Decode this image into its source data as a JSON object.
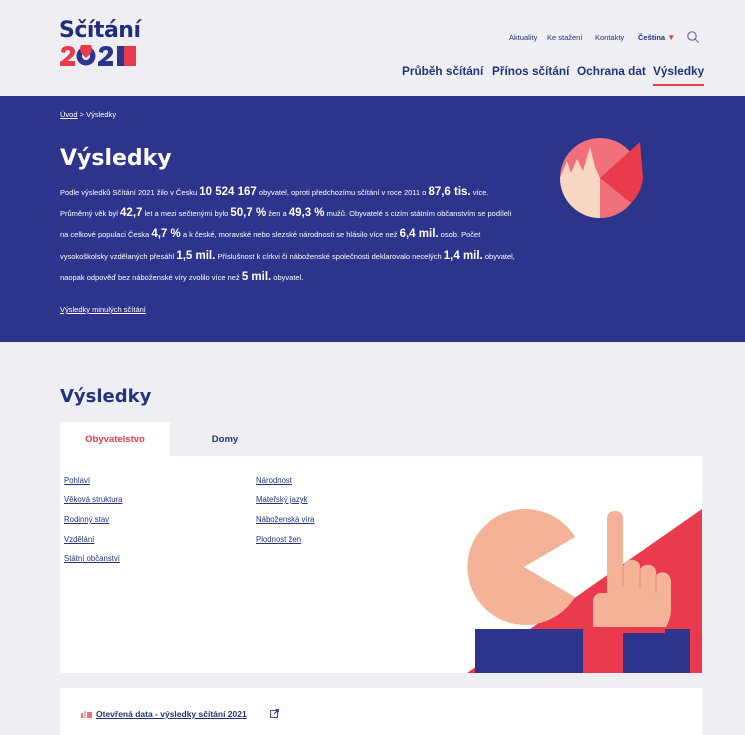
{
  "logo": {
    "text": "Sčítání",
    "year": "2021"
  },
  "utility_nav": [
    {
      "label": "Aktuality"
    },
    {
      "label": "Ke stažení"
    },
    {
      "label": "Kontakty"
    }
  ],
  "language": {
    "label": "Čeština",
    "caret": "▼"
  },
  "main_nav": [
    {
      "label": "Průběh sčítání"
    },
    {
      "label": "Přínos sčítání"
    },
    {
      "label": "Ochrana dat"
    },
    {
      "label": "Výsledky",
      "active": true
    }
  ],
  "breadcrumb": {
    "home": "Úvod",
    "separator": " > ",
    "current": "Výsledky"
  },
  "hero": {
    "title": "Výsledky",
    "p": [
      "Podle výsledků Sčítání 2021 žilo v Česku ",
      "10 524 167",
      " obyvatel, oproti předchozímu sčítání v roce 2011 o ",
      "87,6 tis.",
      " více. Průměrný věk byl ",
      "42,7",
      " let a mezi sečtenými bylo ",
      "50,7 %",
      " žen a ",
      "49,3 %",
      " mužů. Obyvatelé s cizím státním občanstvím se podíleli na celkové populaci Česka ",
      "4,7 %",
      " a k české, moravské nebo slezské národnosti se hlásilo více než ",
      "6,4 mil.",
      " osob. Počet vysokoškolsky vzdělaných přesáhl ",
      "1,5 mil.",
      " Příslušnost k církvi či náboženské společnosti deklarovalo necelých ",
      "1,4 mil.",
      " obyvatel, naopak odpověď bez náboženské víry zvolilo více než ",
      "5 mil.",
      " obyvatel."
    ],
    "past_link": "Výsledky minulých sčítání"
  },
  "results": {
    "title": "Výsledky",
    "tabs": [
      {
        "label": "Obyvatelstvo",
        "active": true
      },
      {
        "label": "Domy",
        "active": false
      }
    ],
    "links_col1": [
      "Pohlaví",
      "Věková struktura",
      "Rodinný stav",
      "Vzdělání",
      "Státní občanství"
    ],
    "links_col2": [
      "Národnost",
      "Mateřský jazyk",
      "Náboženská víra",
      "Plodnost žen"
    ]
  },
  "open_data": {
    "label": "Otevřená data - výsledky sčítání 2021"
  },
  "colors": {
    "navy": "#2c348b",
    "red": "#ea3a4d",
    "peach": "#f4b299",
    "pink": "#f0707c",
    "bg": "#efeff3"
  },
  "icons": {
    "search": "search-icon",
    "external": "external-link-icon",
    "pointer": "hand-pointer-icon"
  }
}
